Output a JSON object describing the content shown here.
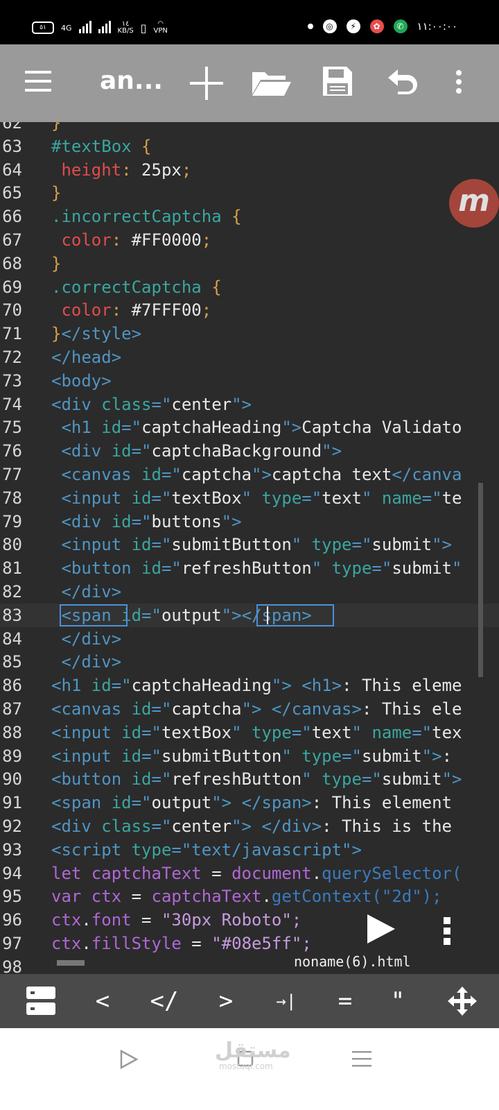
{
  "status_bar": {
    "battery": "٥١",
    "network": "4G",
    "speed_value": "١٤",
    "speed_unit": "KB/S",
    "vpn": "VPN",
    "time": "١١:٠٠:٠٠"
  },
  "toolbar": {
    "title": "an...",
    "icons": [
      "menu-icon",
      "add-icon",
      "folder-open-icon",
      "save-icon",
      "undo-icon",
      "more-vertical-icon"
    ]
  },
  "editor": {
    "file_name": "noname(6).html",
    "current_line": "83",
    "lines": [
      {
        "n": "62",
        "segs": [
          {
            "c": "p",
            "t": "}"
          }
        ]
      },
      {
        "n": "63",
        "segs": [
          {
            "c": "a",
            "t": "#textBox"
          },
          {
            "c": "p",
            "t": " {"
          }
        ]
      },
      {
        "n": "64",
        "segs": [
          {
            "c": "r",
            "t": " height"
          },
          {
            "c": "p",
            "t": ":"
          },
          {
            "c": "s",
            "t": " 25px"
          },
          {
            "c": "p",
            "t": ";"
          }
        ]
      },
      {
        "n": "65",
        "segs": [
          {
            "c": "p",
            "t": "}"
          }
        ]
      },
      {
        "n": "66",
        "segs": [
          {
            "c": "a",
            "t": ".incorrectCaptcha"
          },
          {
            "c": "p",
            "t": " {"
          }
        ]
      },
      {
        "n": "67",
        "segs": [
          {
            "c": "r",
            "t": " color"
          },
          {
            "c": "p",
            "t": ":"
          },
          {
            "c": "s",
            "t": " #FF0000"
          },
          {
            "c": "p",
            "t": ";"
          }
        ]
      },
      {
        "n": "68",
        "segs": [
          {
            "c": "p",
            "t": "}"
          }
        ]
      },
      {
        "n": "69",
        "segs": [
          {
            "c": "a",
            "t": ".correctCaptcha"
          },
          {
            "c": "p",
            "t": " {"
          }
        ]
      },
      {
        "n": "70",
        "segs": [
          {
            "c": "r",
            "t": " color"
          },
          {
            "c": "p",
            "t": ":"
          },
          {
            "c": "s",
            "t": " #7FFF00"
          },
          {
            "c": "p",
            "t": ";"
          }
        ]
      },
      {
        "n": "71",
        "segs": [
          {
            "c": "p",
            "t": "}"
          },
          {
            "c": "t",
            "t": "</style>"
          }
        ]
      },
      {
        "n": "72",
        "segs": [
          {
            "c": "t",
            "t": "</head>"
          }
        ]
      },
      {
        "n": "73",
        "segs": [
          {
            "c": "t",
            "t": "<body>"
          }
        ]
      },
      {
        "n": "74",
        "segs": [
          {
            "c": "t",
            "t": "<div "
          },
          {
            "c": "a",
            "t": "class"
          },
          {
            "c": "t",
            "t": "=\""
          },
          {
            "c": "s",
            "t": "center"
          },
          {
            "c": "t",
            "t": "\">"
          }
        ]
      },
      {
        "n": "75",
        "segs": [
          {
            "c": "t",
            "t": " <h1 "
          },
          {
            "c": "a",
            "t": "id"
          },
          {
            "c": "t",
            "t": "=\""
          },
          {
            "c": "s",
            "t": "captchaHeading"
          },
          {
            "c": "t",
            "t": "\">"
          },
          {
            "c": "s",
            "t": "Captcha Validato"
          }
        ]
      },
      {
        "n": "76",
        "segs": [
          {
            "c": "t",
            "t": " <div "
          },
          {
            "c": "a",
            "t": "id"
          },
          {
            "c": "t",
            "t": "=\""
          },
          {
            "c": "s",
            "t": "captchaBackground"
          },
          {
            "c": "t",
            "t": "\">"
          }
        ]
      },
      {
        "n": "77",
        "segs": [
          {
            "c": "t",
            "t": " <canvas "
          },
          {
            "c": "a",
            "t": "id"
          },
          {
            "c": "t",
            "t": "=\""
          },
          {
            "c": "s",
            "t": "captcha"
          },
          {
            "c": "t",
            "t": "\">"
          },
          {
            "c": "s",
            "t": "captcha text"
          },
          {
            "c": "t",
            "t": "</canva"
          }
        ]
      },
      {
        "n": "78",
        "segs": [
          {
            "c": "t",
            "t": " <input "
          },
          {
            "c": "a",
            "t": "id"
          },
          {
            "c": "t",
            "t": "=\""
          },
          {
            "c": "s",
            "t": "textBox"
          },
          {
            "c": "t",
            "t": "\" "
          },
          {
            "c": "a",
            "t": "type"
          },
          {
            "c": "t",
            "t": "=\""
          },
          {
            "c": "s",
            "t": "text"
          },
          {
            "c": "t",
            "t": "\" "
          },
          {
            "c": "a",
            "t": "name"
          },
          {
            "c": "t",
            "t": "=\""
          },
          {
            "c": "s",
            "t": "te"
          }
        ]
      },
      {
        "n": "79",
        "segs": [
          {
            "c": "t",
            "t": " <div "
          },
          {
            "c": "a",
            "t": "id"
          },
          {
            "c": "t",
            "t": "=\""
          },
          {
            "c": "s",
            "t": "buttons"
          },
          {
            "c": "t",
            "t": "\">"
          }
        ]
      },
      {
        "n": "80",
        "segs": [
          {
            "c": "t",
            "t": " <input "
          },
          {
            "c": "a",
            "t": "id"
          },
          {
            "c": "t",
            "t": "=\""
          },
          {
            "c": "s",
            "t": "submitButton"
          },
          {
            "c": "t",
            "t": "\" "
          },
          {
            "c": "a",
            "t": "type"
          },
          {
            "c": "t",
            "t": "=\""
          },
          {
            "c": "s",
            "t": "submit"
          },
          {
            "c": "t",
            "t": "\">"
          }
        ]
      },
      {
        "n": "81",
        "segs": [
          {
            "c": "t",
            "t": " <button "
          },
          {
            "c": "a",
            "t": "id"
          },
          {
            "c": "t",
            "t": "=\""
          },
          {
            "c": "s",
            "t": "refreshButton"
          },
          {
            "c": "t",
            "t": "\" "
          },
          {
            "c": "a",
            "t": "type"
          },
          {
            "c": "t",
            "t": "=\""
          },
          {
            "c": "s",
            "t": "submit"
          },
          {
            "c": "t",
            "t": "\""
          }
        ]
      },
      {
        "n": "82",
        "segs": [
          {
            "c": "t",
            "t": " </div>"
          }
        ]
      },
      {
        "n": "83",
        "segs": [
          {
            "c": "t",
            "t": " <span "
          },
          {
            "c": "a",
            "t": "id"
          },
          {
            "c": "t",
            "t": "=\""
          },
          {
            "c": "s",
            "t": "output"
          },
          {
            "c": "t",
            "t": "\">"
          },
          {
            "c": "t",
            "t": "</span>"
          }
        ]
      },
      {
        "n": "84",
        "segs": [
          {
            "c": "t",
            "t": " </div>"
          }
        ]
      },
      {
        "n": "85",
        "segs": [
          {
            "c": "t",
            "t": " </div>"
          }
        ]
      },
      {
        "n": "86",
        "segs": [
          {
            "c": "t",
            "t": "<h1 "
          },
          {
            "c": "a",
            "t": "id"
          },
          {
            "c": "t",
            "t": "=\""
          },
          {
            "c": "s",
            "t": "captchaHeading"
          },
          {
            "c": "t",
            "t": "\"> <h1>"
          },
          {
            "c": "s",
            "t": ": This eleme"
          }
        ]
      },
      {
        "n": "87",
        "segs": [
          {
            "c": "t",
            "t": "<canvas "
          },
          {
            "c": "a",
            "t": "id"
          },
          {
            "c": "t",
            "t": "=\""
          },
          {
            "c": "s",
            "t": "captcha"
          },
          {
            "c": "t",
            "t": "\"> </canvas>"
          },
          {
            "c": "s",
            "t": ": This ele"
          }
        ]
      },
      {
        "n": "88",
        "segs": [
          {
            "c": "t",
            "t": "<input "
          },
          {
            "c": "a",
            "t": "id"
          },
          {
            "c": "t",
            "t": "=\""
          },
          {
            "c": "s",
            "t": "textBox"
          },
          {
            "c": "t",
            "t": "\" "
          },
          {
            "c": "a",
            "t": "type"
          },
          {
            "c": "t",
            "t": "=\""
          },
          {
            "c": "s",
            "t": "text"
          },
          {
            "c": "t",
            "t": "\" "
          },
          {
            "c": "a",
            "t": "name"
          },
          {
            "c": "t",
            "t": "=\""
          },
          {
            "c": "s",
            "t": "tex"
          }
        ]
      },
      {
        "n": "89",
        "segs": [
          {
            "c": "t",
            "t": "<input "
          },
          {
            "c": "a",
            "t": "id"
          },
          {
            "c": "t",
            "t": "=\""
          },
          {
            "c": "s",
            "t": "submitButton"
          },
          {
            "c": "t",
            "t": "\" "
          },
          {
            "c": "a",
            "t": "type"
          },
          {
            "c": "t",
            "t": "=\""
          },
          {
            "c": "s",
            "t": "submit"
          },
          {
            "c": "t",
            "t": "\">"
          },
          {
            "c": "s",
            "t": ":"
          }
        ]
      },
      {
        "n": "90",
        "segs": [
          {
            "c": "t",
            "t": "<button "
          },
          {
            "c": "a",
            "t": "id"
          },
          {
            "c": "t",
            "t": "=\""
          },
          {
            "c": "s",
            "t": "refreshButton"
          },
          {
            "c": "t",
            "t": "\" "
          },
          {
            "c": "a",
            "t": "type"
          },
          {
            "c": "t",
            "t": "=\""
          },
          {
            "c": "s",
            "t": "submit"
          },
          {
            "c": "t",
            "t": "\">"
          }
        ]
      },
      {
        "n": "91",
        "segs": [
          {
            "c": "t",
            "t": "<span "
          },
          {
            "c": "a",
            "t": "id"
          },
          {
            "c": "t",
            "t": "=\""
          },
          {
            "c": "s",
            "t": "output"
          },
          {
            "c": "t",
            "t": "\"> </span>"
          },
          {
            "c": "s",
            "t": ": This element"
          }
        ]
      },
      {
        "n": "92",
        "segs": [
          {
            "c": "t",
            "t": "<div "
          },
          {
            "c": "a",
            "t": "class"
          },
          {
            "c": "t",
            "t": "=\""
          },
          {
            "c": "s",
            "t": "center"
          },
          {
            "c": "t",
            "t": "\"> </div>"
          },
          {
            "c": "s",
            "t": ": This is the"
          }
        ]
      },
      {
        "n": "93",
        "segs": [
          {
            "c": "t",
            "t": "<script "
          },
          {
            "c": "a",
            "t": "type"
          },
          {
            "c": "t",
            "t": "=\"text/javascript\">"
          }
        ]
      },
      {
        "n": "94",
        "segs": [
          {
            "c": "k",
            "t": "let captchaText"
          },
          {
            "c": "s",
            "t": " = "
          },
          {
            "c": "k",
            "t": "document"
          },
          {
            "c": "s",
            "t": "."
          },
          {
            "c": "lbr",
            "t": "querySelector("
          }
        ]
      },
      {
        "n": "95",
        "segs": [
          {
            "c": "k",
            "t": "var ctx"
          },
          {
            "c": "s",
            "t": " = "
          },
          {
            "c": "k",
            "t": "captchaText"
          },
          {
            "c": "s",
            "t": "."
          },
          {
            "c": "lbr",
            "t": "getContext(\"2d\");"
          }
        ]
      },
      {
        "n": "96",
        "segs": [
          {
            "c": "k",
            "t": "ctx"
          },
          {
            "c": "s",
            "t": "."
          },
          {
            "c": "k",
            "t": "font"
          },
          {
            "c": "s",
            "t": " = "
          },
          {
            "c": "g",
            "t": "\"30px Roboto\";"
          }
        ]
      },
      {
        "n": "97",
        "segs": [
          {
            "c": "k",
            "t": "ctx"
          },
          {
            "c": "s",
            "t": "."
          },
          {
            "c": "k",
            "t": "fillStyle"
          },
          {
            "c": "s",
            "t": " = "
          },
          {
            "c": "g",
            "t": "\"#08e5ff\";"
          }
        ]
      },
      {
        "n": "98",
        "segs": []
      }
    ]
  },
  "keys": [
    "<",
    "</",
    ">",
    "→|",
    "=",
    "\""
  ],
  "watermark": {
    "brand": "مستقل",
    "site": "mostaql.com"
  }
}
